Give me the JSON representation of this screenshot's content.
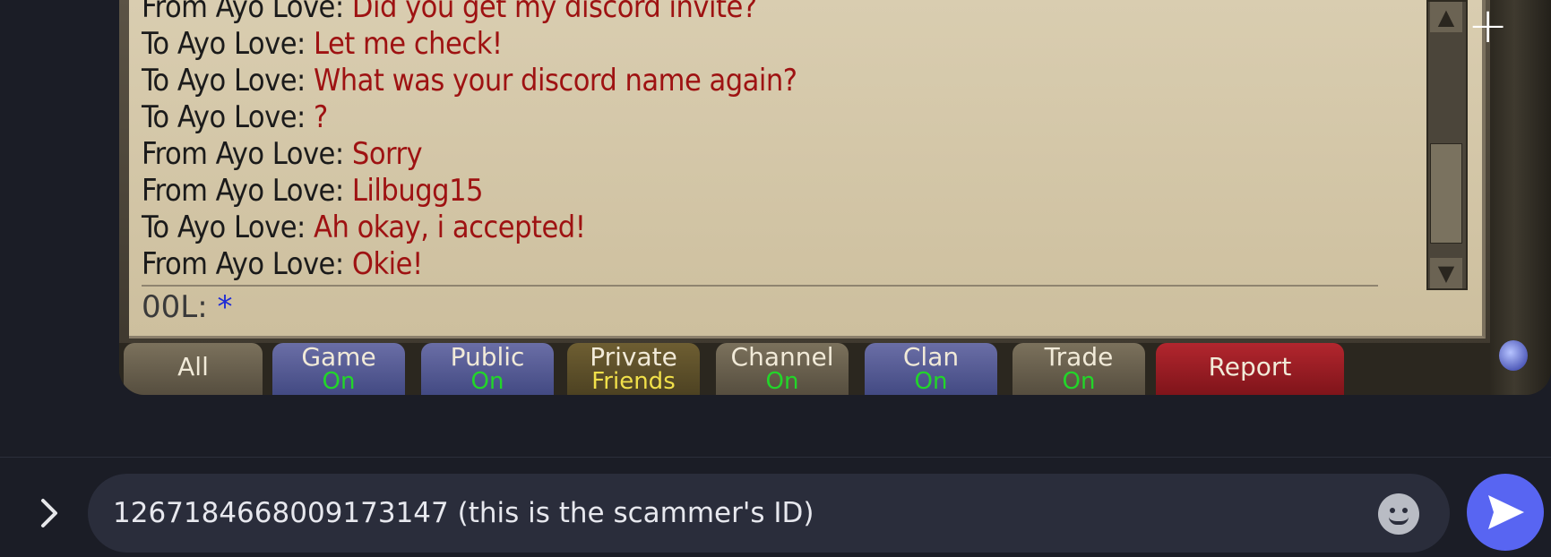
{
  "chat_log": [
    {
      "name": "From Ayo Love: ",
      "message": "Did you get my discord invite?"
    },
    {
      "name": "To Ayo Love: ",
      "message": "Let me check!"
    },
    {
      "name": "To Ayo Love: ",
      "message": "What was your discord name again?"
    },
    {
      "name": "To Ayo Love: ",
      "message": "?"
    },
    {
      "name": "From Ayo Love: ",
      "message": "Sorry"
    },
    {
      "name": "From Ayo Love: ",
      "message": "Lilbugg15"
    },
    {
      "name": "To Ayo Love: ",
      "message": "Ah okay, i accepted!"
    },
    {
      "name": "From Ayo Love: ",
      "message": "Okie!"
    }
  ],
  "game_input": {
    "name": "00L: ",
    "caret": "*"
  },
  "tabs": [
    {
      "label": "All",
      "status": ""
    },
    {
      "label": "Game",
      "status": "On"
    },
    {
      "label": "Public",
      "status": "On"
    },
    {
      "label": "Private",
      "status": "Friends"
    },
    {
      "label": "Channel",
      "status": "On"
    },
    {
      "label": "Clan",
      "status": "On"
    },
    {
      "label": "Trade",
      "status": "On"
    },
    {
      "label": "Report",
      "status": ""
    }
  ],
  "composer": {
    "message": "1267184668009173147 (this is the scammer's ID)",
    "expand_icon": "chevron-right-icon",
    "emoji_icon": "emoji-icon",
    "send_icon": "send-icon"
  },
  "colors": {
    "accent": "#5865f2",
    "background": "#1b1d26",
    "input_background": "#2a2d3b"
  }
}
